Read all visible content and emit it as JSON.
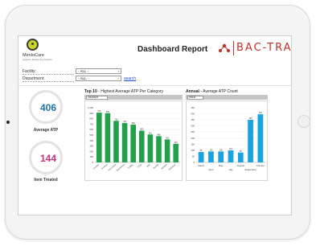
{
  "header": {
    "logo_text": "MenloCare",
    "logo_sub": "Hygiene Monitoring System",
    "title": "Dashboard Report",
    "brand_text": "BAC-TRACK",
    "brand_color": "#c0312b"
  },
  "filters": {
    "facility_label": "Facility:",
    "facility_value": "- ALL -",
    "department_label": "Department:",
    "department_value": "- ALL -",
    "search_label": "search"
  },
  "kpis": {
    "avg_atp_value": "406",
    "avg_atp_label": "Average ATP",
    "avg_atp_color": "#1f6fa8",
    "item_treated_value": "144",
    "item_treated_label": "Item Treated",
    "item_treated_color": "#c2307e"
  },
  "panel_top10": {
    "title_bold": "Top 10",
    "title_rest": " - Highest Average ATP Per Category",
    "period": "10/2015"
  },
  "panel_annual": {
    "title_bold": "Annual",
    "title_rest": " - Average ATP Count",
    "period": "2015"
  },
  "chart_data": [
    {
      "type": "bar",
      "title": "Top 10 - Highest Average ATP Per Category",
      "bar_color": "#22a04a",
      "ylim": [
        0,
        1000
      ],
      "yticks": [
        "0",
        "100",
        "200",
        "300",
        "400",
        "500",
        "600",
        "700",
        "800",
        "900",
        "1,000"
      ],
      "categories": [
        "Counter",
        "Surface",
        "Instrument",
        "Equipment",
        "Trolley",
        "Chair",
        "Bed",
        "Handle",
        "Monitor",
        "Keyboard"
      ],
      "values": [
        910,
        900,
        760,
        720,
        690,
        580,
        510,
        480,
        420,
        340
      ]
    },
    {
      "type": "bar",
      "title": "Annual - Average ATP Count",
      "bar_color": "#1aa3e0",
      "ylim": [
        0,
        500
      ],
      "yticks": [
        "0",
        "50",
        "100",
        "150",
        "200",
        "250",
        "300",
        "350",
        "400",
        "450"
      ],
      "categories": [
        "March",
        "April",
        "May",
        "July",
        "August",
        "September",
        "October"
      ],
      "x_labels_top": [
        "March",
        "",
        "May",
        "",
        "August",
        "",
        "October"
      ],
      "x_labels_bottom": [
        "",
        "April",
        "",
        "July",
        "",
        "September",
        ""
      ],
      "values": [
        95,
        100,
        100,
        110,
        90,
        390,
        440
      ]
    }
  ]
}
